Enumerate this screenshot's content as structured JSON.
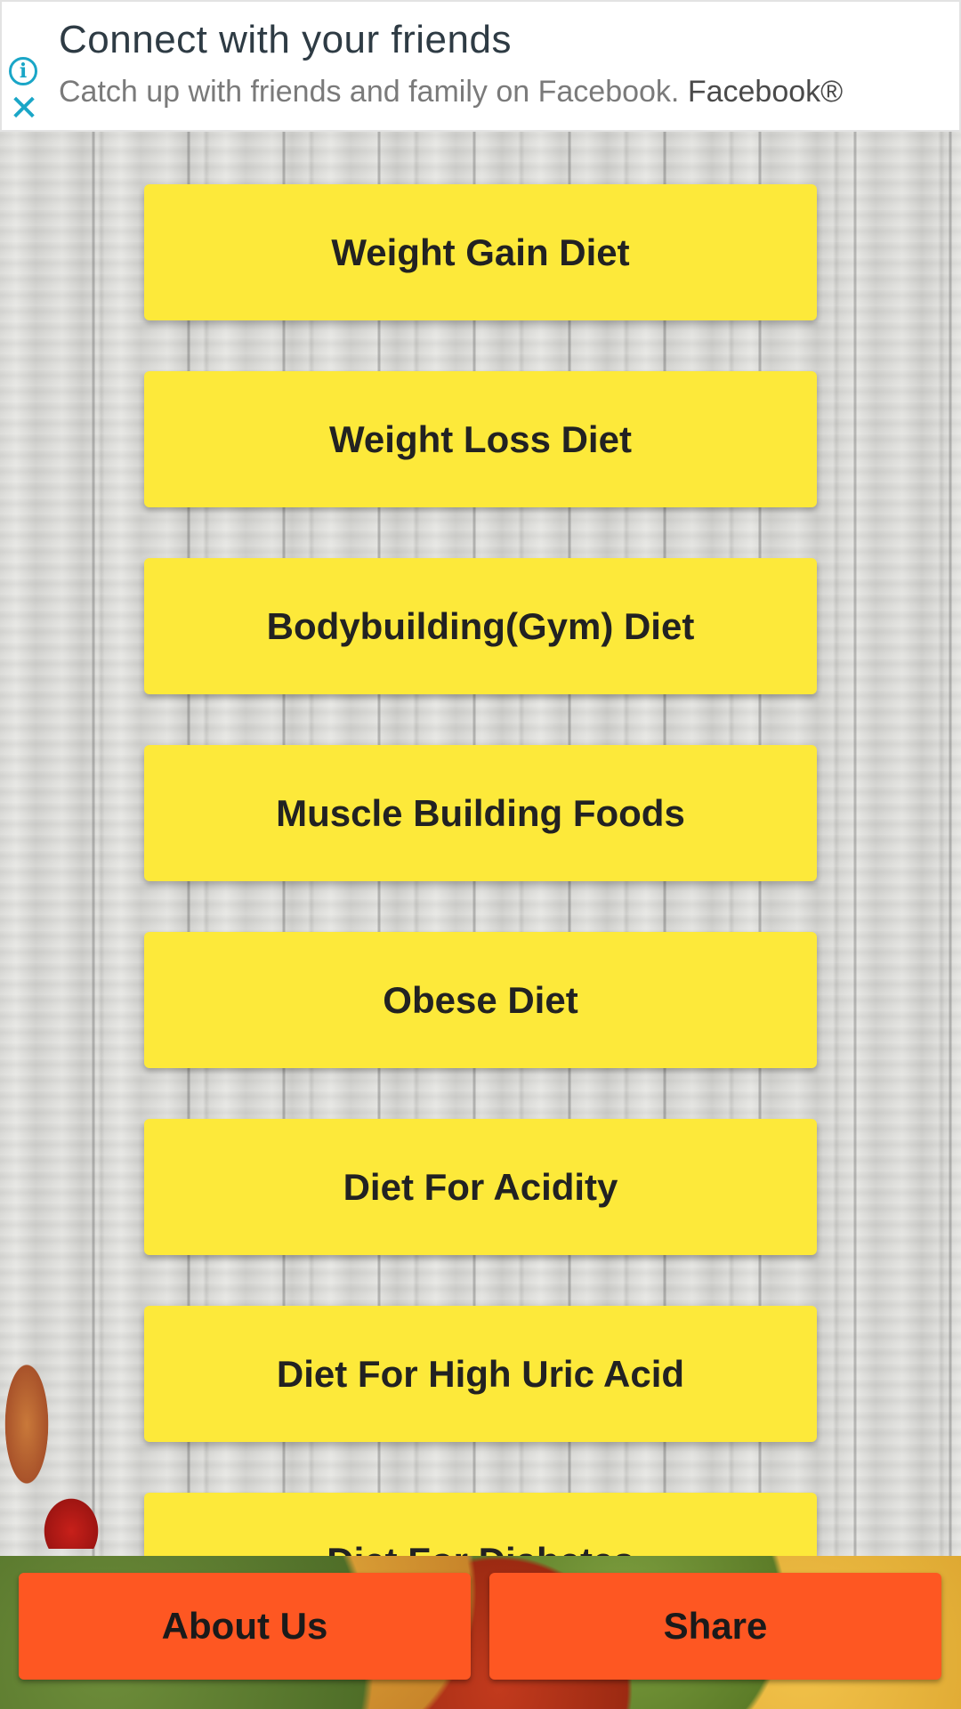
{
  "ad": {
    "title": "Connect with your friends",
    "subtitle": "Catch up with friends and family on Facebook.",
    "brand": "Facebook®",
    "info_glyph": "i",
    "close_glyph": "✕"
  },
  "menu": {
    "items": [
      {
        "label": "Weight Gain Diet"
      },
      {
        "label": "Weight Loss Diet"
      },
      {
        "label": "Bodybuilding(Gym) Diet"
      },
      {
        "label": "Muscle Building Foods"
      },
      {
        "label": "Obese Diet"
      },
      {
        "label": "Diet For Acidity"
      },
      {
        "label": "Diet For High Uric Acid"
      },
      {
        "label": "Diet For Diabetes"
      }
    ]
  },
  "bottom": {
    "about_label": "About Us",
    "share_label": "Share"
  },
  "colors": {
    "menu_button": "#fde93a",
    "bottom_button": "#fe5722",
    "ad_icon": "#1aa6c7"
  }
}
